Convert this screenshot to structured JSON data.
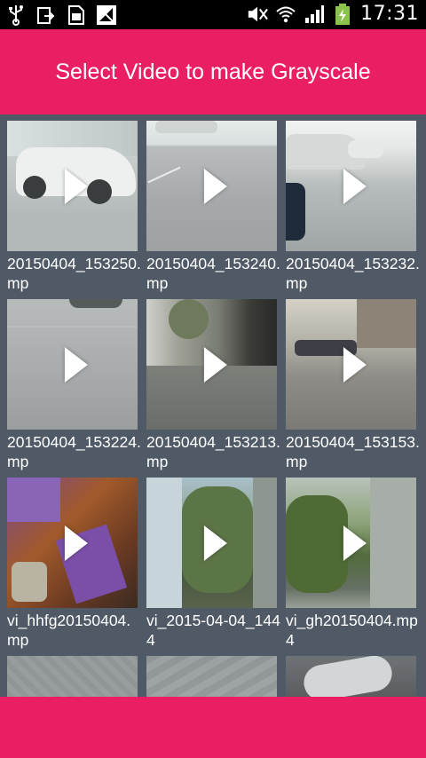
{
  "status_bar": {
    "time": "17:31",
    "left_icons": [
      "usb-icon",
      "share-icon",
      "sim-card-icon",
      "signal-blocked-icon"
    ],
    "right_icons": [
      "mute-icon",
      "wifi-icon",
      "cellular-signal-icon",
      "battery-charging-icon"
    ]
  },
  "header": {
    "title": "Select Video to make Grayscale",
    "background": "#e91e63"
  },
  "grid": {
    "items": [
      {
        "filename": "20150404_153250.mp"
      },
      {
        "filename": "20150404_153240.mp"
      },
      {
        "filename": "20150404_153232.mp"
      },
      {
        "filename": "20150404_153224.mp"
      },
      {
        "filename": "20150404_153213.mp"
      },
      {
        "filename": "20150404_153153.mp"
      },
      {
        "filename": "vi_hhfg20150404.mp"
      },
      {
        "filename": "vi_2015-04-04_1444"
      },
      {
        "filename": "vi_gh20150404.mp4"
      }
    ]
  },
  "bottom_bar": {
    "background": "#e91e63"
  }
}
